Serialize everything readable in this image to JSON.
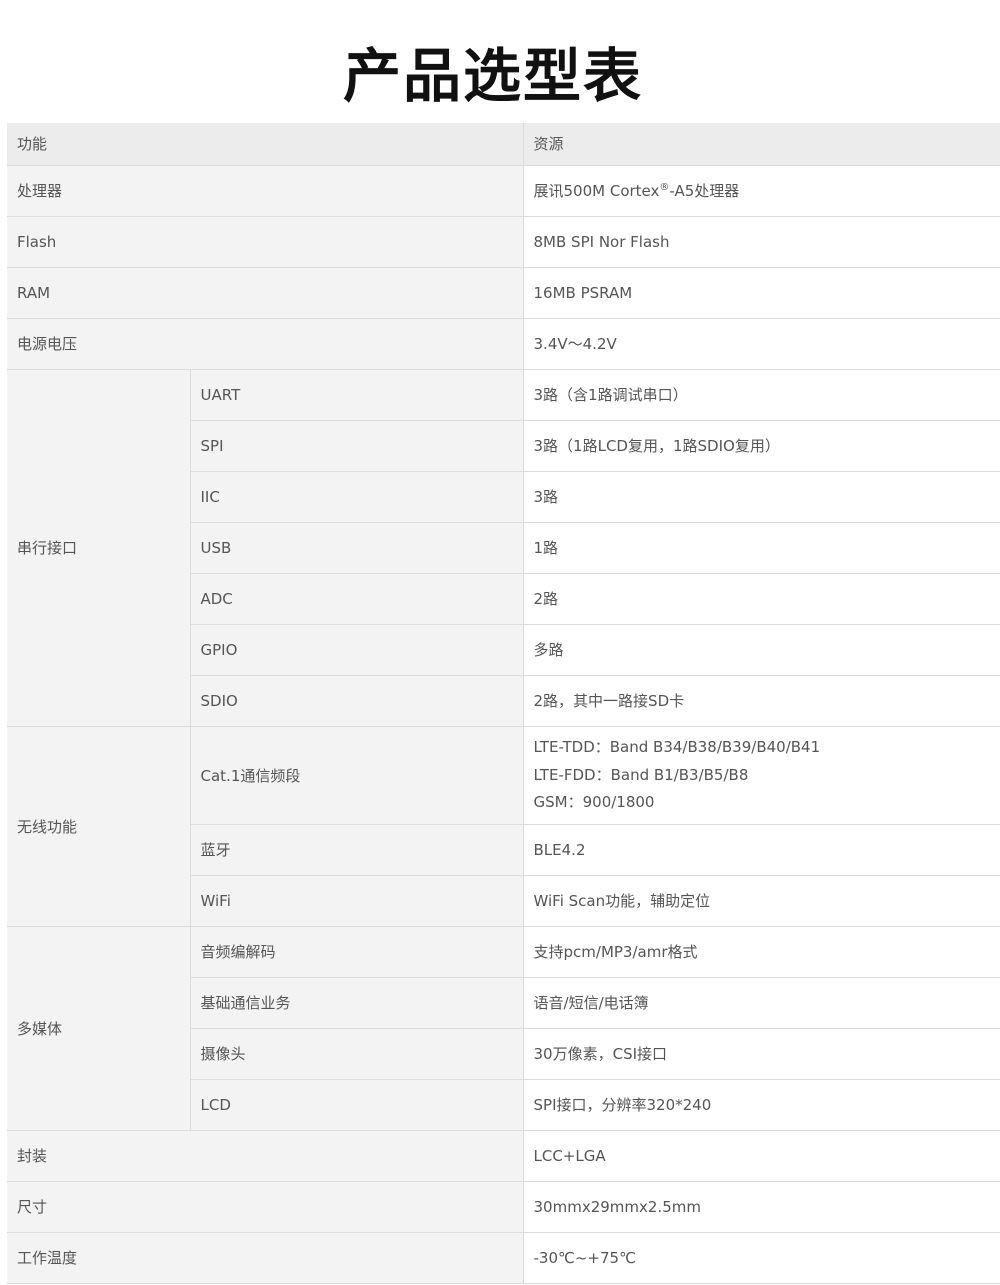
{
  "title": "产品选型表",
  "header": {
    "function": "功能",
    "resource": "资源"
  },
  "rows": {
    "cpu": {
      "label": "处理器",
      "value_pre": "展讯500M Cortex",
      "value_sup": "®",
      "value_post": "-A5处理器"
    },
    "flash": {
      "label": "Flash",
      "value": "8MB SPI Nor Flash"
    },
    "ram": {
      "label": "RAM",
      "value": "16MB PSRAM"
    },
    "voltage": {
      "label": "电源电压",
      "value": "3.4V～4.2V"
    }
  },
  "serial": {
    "group": "串行接口",
    "items": [
      {
        "label": "UART",
        "value": "3路（含1路调试串口）"
      },
      {
        "label": "SPI",
        "value": "3路（1路LCD复用，1路SDIO复用）"
      },
      {
        "label": "IIC",
        "value": "3路"
      },
      {
        "label": "USB",
        "value": "1路"
      },
      {
        "label": "ADC",
        "value": "2路"
      },
      {
        "label": "GPIO",
        "value": "多路"
      },
      {
        "label": "SDIO",
        "value": "2路，其中一路接SD卡"
      }
    ]
  },
  "wireless": {
    "group": "无线功能",
    "cat1": {
      "label": "Cat.1通信频段",
      "lines": [
        "LTE-TDD：Band B34/B38/B39/B40/B41",
        "LTE-FDD：Band B1/B3/B5/B8",
        "GSM：900/1800"
      ]
    },
    "bt": {
      "label": "蓝牙",
      "value": "BLE4.2"
    },
    "wifi": {
      "label": "WiFi",
      "value": "WiFi Scan功能，辅助定位"
    }
  },
  "multimedia": {
    "group": "多媒体",
    "items": [
      {
        "label": "音频编解码",
        "value": "支持pcm/MP3/amr格式"
      },
      {
        "label": "基础通信业务",
        "value": "语音/短信/电话簿"
      },
      {
        "label": "摄像头",
        "value": "30万像素，CSI接口"
      },
      {
        "label": "LCD",
        "value": "SPI接口，分辨率320*240"
      }
    ]
  },
  "tail": {
    "package": {
      "label": "封装",
      "value": "LCC+LGA"
    },
    "size": {
      "label": "尺寸",
      "value": "30mmx29mmx2.5mm"
    },
    "temp": {
      "label": "工作温度",
      "value": "-30℃~+75℃"
    }
  }
}
